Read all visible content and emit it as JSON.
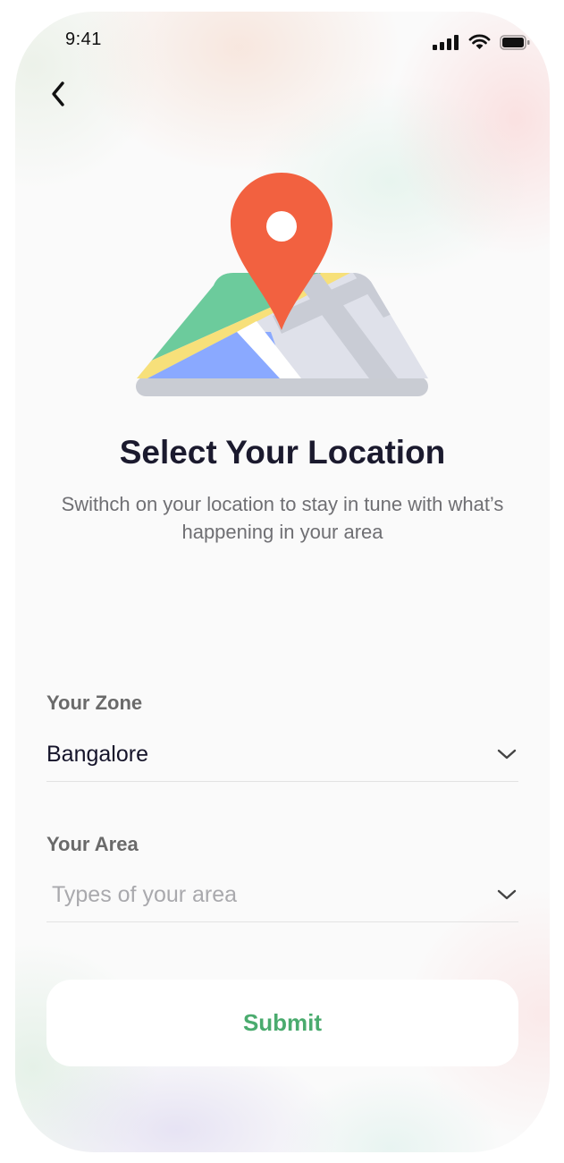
{
  "status_bar": {
    "time": "9:41",
    "icons": [
      "cellular-signal-icon",
      "wifi-icon",
      "battery-icon"
    ]
  },
  "nav": {
    "back_icon": "chevron-left-icon"
  },
  "illustration": {
    "icon": "map-pin-icon",
    "colors": {
      "pin": "#f26140",
      "map_green": "#6ccb9c",
      "map_yellow": "#f7e07a",
      "map_blue": "#8aa9ff",
      "map_grey": "#dfe1ea",
      "base": "#c9ccd3"
    }
  },
  "header": {
    "title": "Select Your Location",
    "subtitle": "Swithch on your location to stay in tune with what’s happening in your area"
  },
  "form": {
    "zone": {
      "label": "Your Zone",
      "value": "Bangalore"
    },
    "area": {
      "label": "Your Area",
      "placeholder": "Types of your area"
    },
    "submit_label": "Submit"
  },
  "colors": {
    "accent_green": "#4aab6e",
    "title_color": "#1b1a2e"
  }
}
